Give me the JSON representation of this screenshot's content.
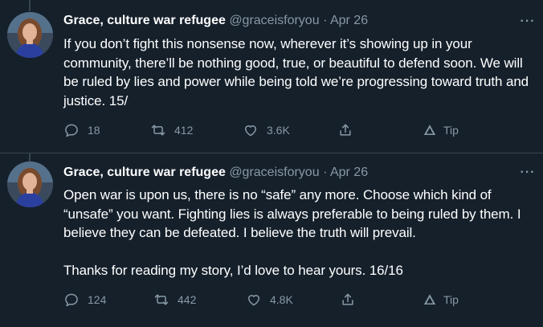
{
  "tweets": [
    {
      "author_name": "Grace, culture war refugee",
      "handle": "@graceisforyou",
      "separator": "·",
      "date": "Apr 26",
      "more": "···",
      "text": "If you don’t fight this nonsense now, wherever it’s showing up in your community, there’ll be nothing good, true, or beautiful to defend soon. We will be ruled by lies and power while being told we’re progressing toward truth and justice. 15/",
      "replies": "18",
      "retweets": "412",
      "likes": "3.6K",
      "tip_label": "Tip"
    },
    {
      "author_name": "Grace, culture war refugee",
      "handle": "@graceisforyou",
      "separator": "·",
      "date": "Apr 26",
      "more": "···",
      "text": "Open war is upon us, there is no “safe” any more. Choose which kind of “unsafe” you want. Fighting lies is always preferable to being ruled by them. I believe they can be defeated. I believe the truth will prevail.\n\nThanks for reading my story, I’d love to hear yours. 16/16",
      "replies": "124",
      "retweets": "442",
      "likes": "4.8K",
      "tip_label": "Tip"
    }
  ],
  "colors": {
    "background": "#15202b",
    "text": "#ffffff",
    "secondary": "#8899a6",
    "divider": "#38444d"
  },
  "icons": [
    "reply-icon",
    "retweet-icon",
    "like-icon",
    "share-icon",
    "tip-icon",
    "more-icon"
  ]
}
